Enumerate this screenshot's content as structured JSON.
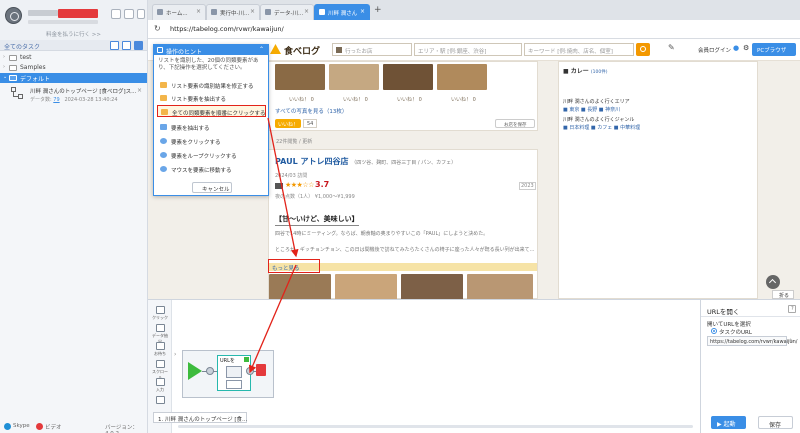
{
  "left_panel": {
    "subtitle": "料金を払うに行く >>",
    "section_label": "全てのタスク",
    "tree": [
      {
        "label": "test"
      },
      {
        "label": "Samples"
      },
      {
        "label": "デフォルト"
      }
    ],
    "task": {
      "title": "川畔 潤さんのトップページ [食べログ]ス...",
      "meta_prefix": "データ数:",
      "count": "79",
      "date": "2024-03-28 13:40:24"
    },
    "footer": {
      "skype": "Skype",
      "video": "ビデオ",
      "version": "バージョン：4.0.2"
    }
  },
  "browser": {
    "tabs": [
      {
        "label": "ホーム..."
      },
      {
        "label": "実行中-川..."
      },
      {
        "label": "データ-川..."
      },
      {
        "label": "川畔 潤さん"
      }
    ],
    "new_tab": "+",
    "url": "https://tabelog.com/rvwr/kawaijun/"
  },
  "site": {
    "logo": "食べログ",
    "search_place_prefix": "行ったお店",
    "search_area_placeholder": "エリア・駅 [例:銀座、渋谷]",
    "search_keyword_placeholder": "キーワード [例:焼肉、店名、個室]",
    "login": "会員ログイン",
    "pc_browser": "PCブラウザ",
    "post1": {
      "likes": [
        "いいね！ 0",
        "いいね！ 0",
        "いいね！ 0",
        "いいね！ 0"
      ],
      "all_photos": "すべての写真を見る（13枚）",
      "iine": "いいね！",
      "iine_count": "54",
      "save": "お店を保存",
      "views": "22件閲覧 / 更新"
    },
    "post2": {
      "name": "PAUL アトレ四谷店",
      "area": "（四ツ谷、麹町、四谷三丁目 / パン、カフェ）",
      "visit": "2024/03 訪問",
      "stars": "★★★☆☆",
      "score": "3.7",
      "year_badge": "2023",
      "price_info": "夜の点数（1人）   ¥1,000～¥1,999",
      "review_title": "【甘～いけど、美味しい】",
      "para1": "四谷で14時にミーティング。ならば、朝食軸の奥まりやすいこの「PAUL」にしようと決めた。",
      "para2": "ところが、ギッチョンチョン、この日は間機後で訪ねてみたらたくさんの椅子に座った人々が既る長い列が出来て...",
      "more": "もっと見る"
    },
    "sidebar": {
      "curry": "カレー",
      "curry_count": "(100件)",
      "area_heading": "川畔 潤さんのよく行くエリア",
      "area_tags": "■ 東京  ■ 長野  ■ 神奈川",
      "genre_heading": "川畔 潤さんのよく行くジャンル",
      "genre_tags": "■ 日本料理  ■ カフェ  ■ 中華料理"
    },
    "fold": "折る"
  },
  "tips": {
    "title": "操作のヒント",
    "description": "リストを識別した、20個の同類要素があり、下記操作を選択してください。",
    "options": [
      {
        "label": "リスト要素の識別結果を修正する"
      },
      {
        "label": "リスト要素を抽出する"
      },
      {
        "label": "全ての同類要素を順番にクリックする"
      },
      {
        "label": "要素を抽出する"
      },
      {
        "label": "要素をクリックする"
      },
      {
        "label": "要素をループクリックする"
      },
      {
        "label": "マウスを要素に移動する"
      }
    ],
    "cancel": "キャンセル"
  },
  "palette": [
    {
      "label": "クリック"
    },
    {
      "label": "データ抽出"
    },
    {
      "label": "お待ち"
    },
    {
      "label": "スクロール"
    },
    {
      "label": "入力"
    }
  ],
  "workflow": {
    "step_label": "URLを",
    "breadcrumb": "1. 川畔 潤さんのトップページ [食..."
  },
  "properties": {
    "title": "URLを開く",
    "help": "?",
    "open_label": "開いてURLを選択",
    "radio_label": "タスクのURL",
    "url_value": "https://tabelog.com/rvwr/kawaijun/"
  },
  "actions": {
    "run": "▶ 起動",
    "save": "保存"
  },
  "colors": {
    "accent": "#3a8ee6",
    "highlight": "#e2231a",
    "tabelog_orange": "#f39800"
  }
}
